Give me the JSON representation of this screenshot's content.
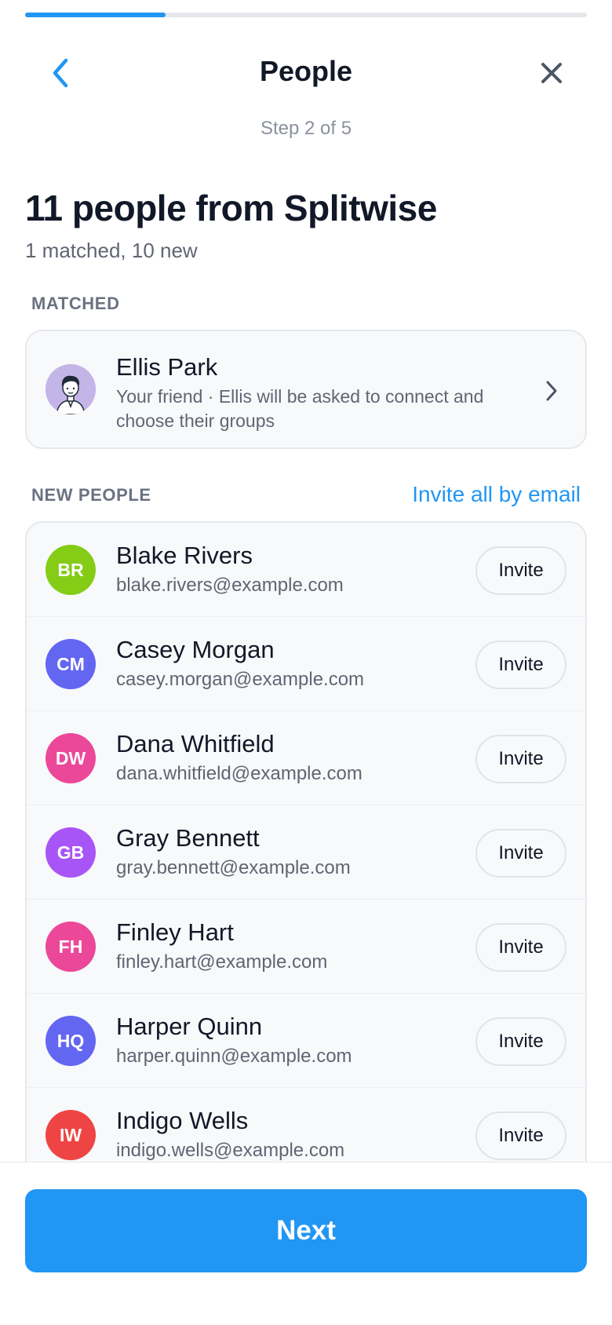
{
  "progress": {
    "value": 0.25
  },
  "header": {
    "title": "People",
    "back_icon": "chevron-left-icon",
    "close_icon": "close-icon",
    "step": "Step 2 of 5"
  },
  "summary": {
    "title": "11 people from Splitwise",
    "subtitle": "1 matched, 10 new"
  },
  "matched": {
    "label": "MATCHED",
    "person": {
      "name": "Ellis Park",
      "description": "Your friend · Ellis will be asked to connect and choose their groups"
    }
  },
  "new_people": {
    "label": "NEW PEOPLE",
    "invite_all": "Invite all by email",
    "invite_label": "Invite",
    "items": [
      {
        "initials": "BR",
        "name": "Blake Rivers",
        "email": "blake.rivers@example.com",
        "color": "#84cc16"
      },
      {
        "initials": "CM",
        "name": "Casey Morgan",
        "email": "casey.morgan@example.com",
        "color": "#6366f1"
      },
      {
        "initials": "DW",
        "name": "Dana Whitfield",
        "email": "dana.whitfield@example.com",
        "color": "#ec4899"
      },
      {
        "initials": "GB",
        "name": "Gray Bennett",
        "email": "gray.bennett@example.com",
        "color": "#a855f7"
      },
      {
        "initials": "FH",
        "name": "Finley Hart",
        "email": "finley.hart@example.com",
        "color": "#ec4899"
      },
      {
        "initials": "HQ",
        "name": "Harper Quinn",
        "email": "harper.quinn@example.com",
        "color": "#6366f1"
      },
      {
        "initials": "IW",
        "name": "Indigo Wells",
        "email": "indigo.wells@example.com",
        "color": "#ef4444"
      }
    ]
  },
  "footer": {
    "next_label": "Next"
  },
  "colors": {
    "accent": "#2196f3",
    "text": "#111827",
    "muted": "#5f6673"
  }
}
